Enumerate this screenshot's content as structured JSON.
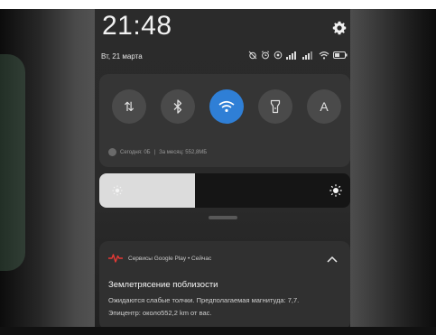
{
  "status_bar": {
    "time": "21:48",
    "date": "Вт, 21 марта"
  },
  "quick_settings": {
    "toggles": [
      {
        "name": "mobile-data",
        "glyph": "⇅",
        "active": false
      },
      {
        "name": "bluetooth",
        "glyph": "✱",
        "active": false
      },
      {
        "name": "wifi",
        "glyph": "wifi",
        "active": true
      },
      {
        "name": "flashlight",
        "glyph": "flashlight",
        "active": false
      },
      {
        "name": "auto-brightness",
        "glyph": "A",
        "active": false
      }
    ],
    "data_today": "Сегодня: 0Б",
    "data_separator": "|",
    "data_month": "За месяц: 552,8МБ",
    "active_color": "#2f7fd6"
  },
  "brightness": {
    "level": 0.38
  },
  "notification": {
    "app_label": "Сервисы Google Play • Сейчас",
    "title": "Землетрясение поблизости",
    "body_line1": "Ожидаются слабые толчки. Предполагаемая магнитуда: 7,7.",
    "body_line2": "Эпицентр: около552,2 km от вас.",
    "icon_color": "#e53935"
  }
}
